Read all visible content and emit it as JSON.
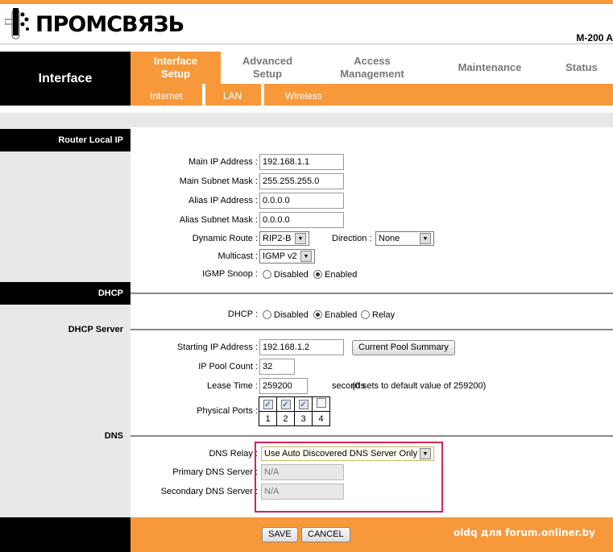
{
  "brand": {
    "logo_text": "ПРОМСВЯЗЬ",
    "model": "M-200 A"
  },
  "nav": {
    "section": "Interface",
    "tabs": [
      {
        "label1": "Interface",
        "label2": "Setup"
      },
      {
        "label1": "Advanced",
        "label2": "Setup"
      },
      {
        "label1": "Access",
        "label2": "Management"
      },
      {
        "label": "Maintenance"
      },
      {
        "label": "Status"
      }
    ],
    "subtabs": [
      "Internet",
      "LAN",
      "Wireless"
    ]
  },
  "router_local_ip": {
    "header": "Router Local IP",
    "main_ip_label": "Main IP Address :",
    "main_ip": "192.168.1.1",
    "main_mask_label": "Main Subnet Mask :",
    "main_mask": "255.255.255.0",
    "alias_ip_label": "Alias IP Address :",
    "alias_ip": "0.0.0.0",
    "alias_mask_label": "Alias Subnet Mask :",
    "alias_mask": "0.0.0.0",
    "dynamic_route_label": "Dynamic Route :",
    "dynamic_route": "RIP2-B",
    "direction_label": "Direction :",
    "direction": "None",
    "multicast_label": "Multicast :",
    "multicast": "IGMP v2",
    "igmp_label": "IGMP Snoop :",
    "disabled": "Disabled",
    "enabled": "Enabled",
    "igmp_value": "Enabled"
  },
  "dhcp": {
    "header": "DHCP",
    "dhcp_label": "DHCP :",
    "options": [
      "Disabled",
      "Enabled",
      "Relay"
    ],
    "selected": "Enabled",
    "server_label": "DHCP Server",
    "start_ip_label": "Starting IP Address :",
    "start_ip": "192.168.1.2",
    "pool_button": "Current Pool Summary",
    "pool_count_label": "IP Pool Count :",
    "pool_count": "32",
    "lease_label": "Lease Time :",
    "lease": "259200",
    "lease_unit": "seconds",
    "lease_note": "(0 sets to default value of 259200)",
    "ports_label": "Physical Ports :",
    "ports": [
      {
        "n": "1",
        "checked": true
      },
      {
        "n": "2",
        "checked": true
      },
      {
        "n": "3",
        "checked": true
      },
      {
        "n": "4",
        "checked": false
      }
    ]
  },
  "dns": {
    "label": "DNS",
    "relay_label": "DNS Relay :",
    "relay": "Use Auto Discovered DNS Server Only",
    "primary_label": "Primary DNS Server :",
    "primary": "N/A",
    "secondary_label": "Secondary DNS Server :",
    "secondary": "N/A"
  },
  "footer": {
    "save": "SAVE",
    "cancel": "CANCEL",
    "watermark": "oldq для forum.onliner.by"
  },
  "colors": {
    "accent": "#f7993a",
    "highlight": "#d0245a"
  }
}
